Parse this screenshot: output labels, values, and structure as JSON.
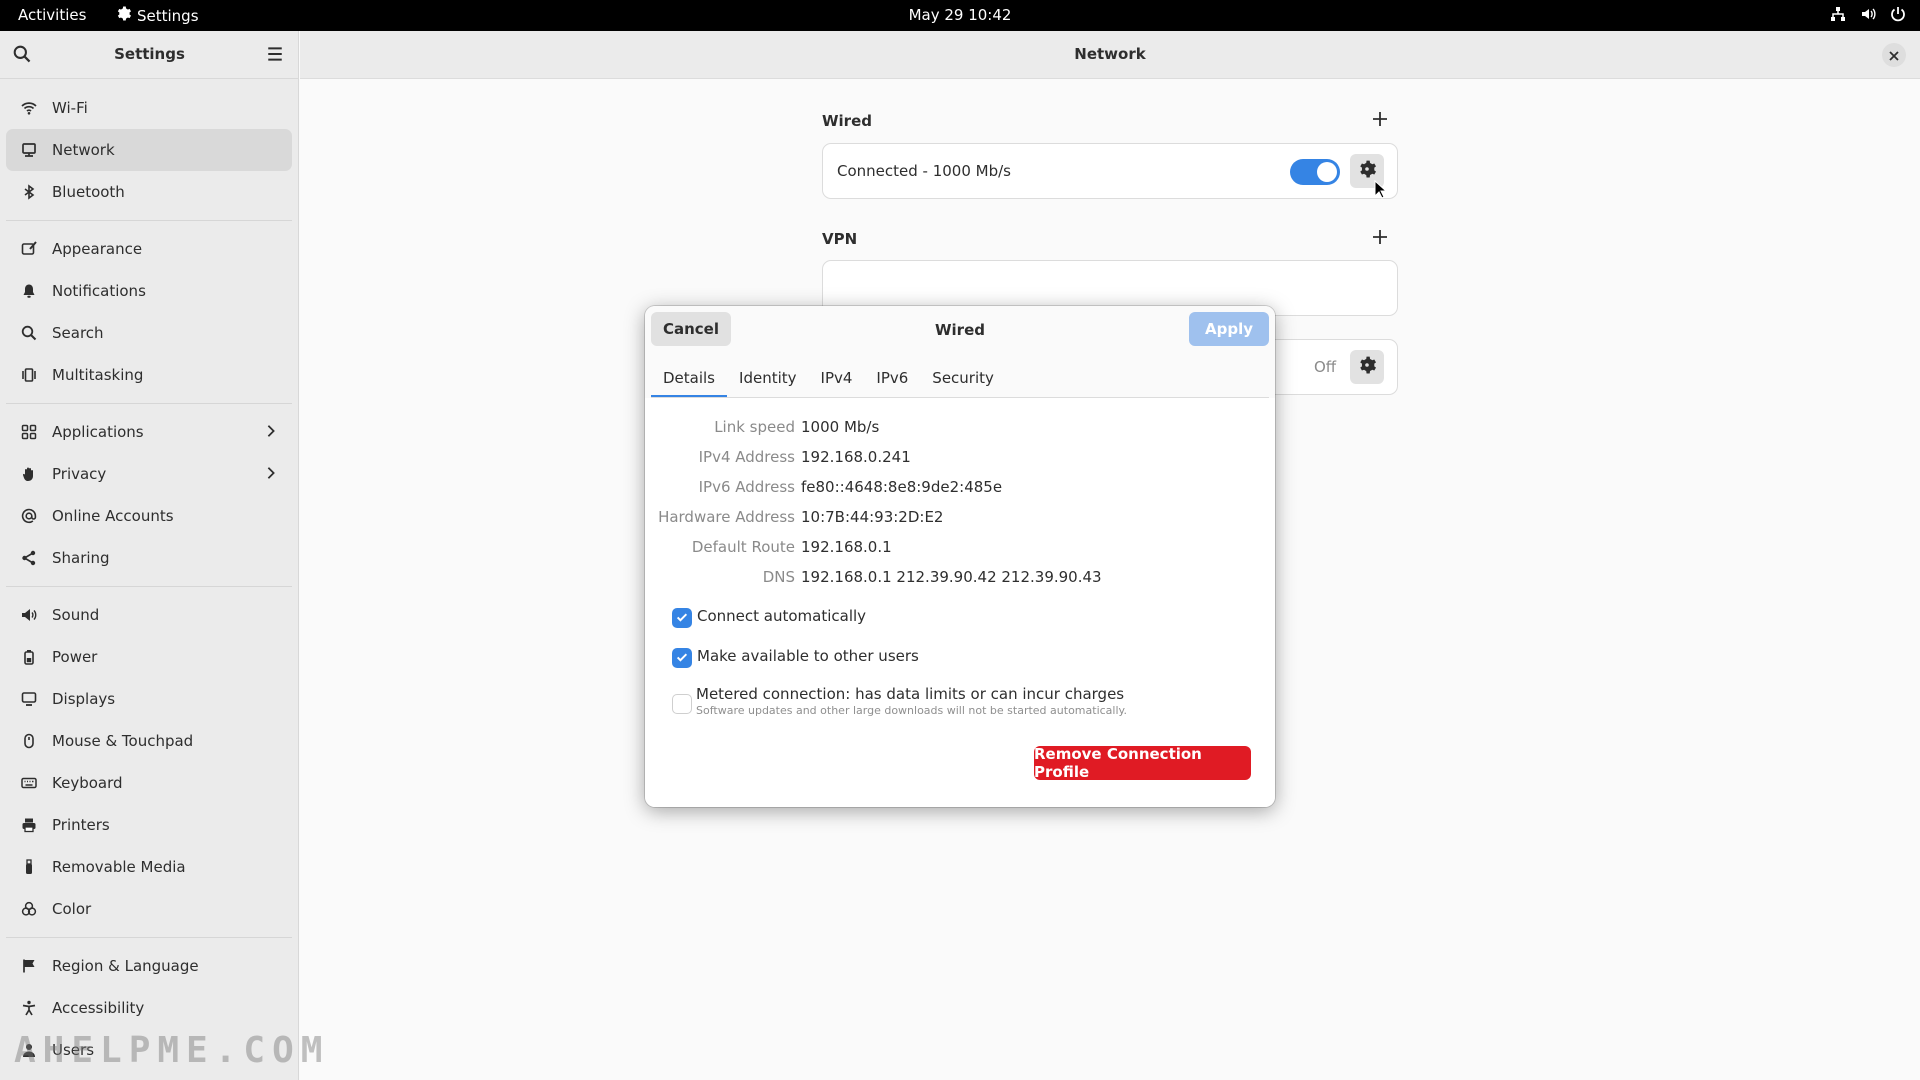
{
  "topbar": {
    "activities": "Activities",
    "app_name": "Settings",
    "clock": "May 29  10:42"
  },
  "sidebar": {
    "title": "Settings",
    "items": [
      {
        "label": "Wi-Fi",
        "icon": "wifi-icon"
      },
      {
        "label": "Network",
        "icon": "network-icon"
      },
      {
        "label": "Bluetooth",
        "icon": "bluetooth-icon"
      },
      {
        "label": "Appearance",
        "icon": "appearance-icon"
      },
      {
        "label": "Notifications",
        "icon": "bell-icon"
      },
      {
        "label": "Search",
        "icon": "search-icon"
      },
      {
        "label": "Multitasking",
        "icon": "multitasking-icon"
      },
      {
        "label": "Applications",
        "icon": "grid-icon"
      },
      {
        "label": "Privacy",
        "icon": "hand-icon"
      },
      {
        "label": "Online Accounts",
        "icon": "at-icon"
      },
      {
        "label": "Sharing",
        "icon": "share-icon"
      },
      {
        "label": "Sound",
        "icon": "speaker-icon"
      },
      {
        "label": "Power",
        "icon": "battery-icon"
      },
      {
        "label": "Displays",
        "icon": "display-icon"
      },
      {
        "label": "Mouse & Touchpad",
        "icon": "mouse-icon"
      },
      {
        "label": "Keyboard",
        "icon": "keyboard-icon"
      },
      {
        "label": "Printers",
        "icon": "printer-icon"
      },
      {
        "label": "Removable Media",
        "icon": "usb-icon"
      },
      {
        "label": "Color",
        "icon": "color-icon"
      },
      {
        "label": "Region & Language",
        "icon": "flag-icon"
      },
      {
        "label": "Accessibility",
        "icon": "accessibility-icon"
      },
      {
        "label": "Users",
        "icon": "users-icon"
      }
    ]
  },
  "main": {
    "title": "Network",
    "wired_title": "Wired",
    "wired_status": "Connected - 1000 Mb/s",
    "vpn_title": "VPN",
    "proxy_status": "Off"
  },
  "dialog": {
    "title": "Wired",
    "cancel": "Cancel",
    "apply": "Apply",
    "tabs": [
      "Details",
      "Identity",
      "IPv4",
      "IPv6",
      "Security"
    ],
    "details": [
      {
        "key": "Link speed",
        "value": "1000 Mb/s"
      },
      {
        "key": "IPv4 Address",
        "value": "192.168.0.241"
      },
      {
        "key": "IPv6 Address",
        "value": "fe80::4648:8e8:9de2:485e"
      },
      {
        "key": "Hardware Address",
        "value": "10:7B:44:93:2D:E2"
      },
      {
        "key": "Default Route",
        "value": "192.168.0.1"
      },
      {
        "key": "DNS",
        "value": "192.168.0.1 212.39.90.42 212.39.90.43"
      }
    ],
    "connect_auto": "Connect automatically",
    "available_users": "Make available to other users",
    "metered": "Metered connection: has data limits or can incur charges",
    "metered_sub": "Software updates and other large downloads will not be started automatically.",
    "remove": "Remove Connection Profile"
  },
  "watermark": "AHELPME.COM",
  "colors": {
    "accent": "#3584e4",
    "destructive": "#e01b24",
    "apply_disabled": "#9fc1ee"
  }
}
